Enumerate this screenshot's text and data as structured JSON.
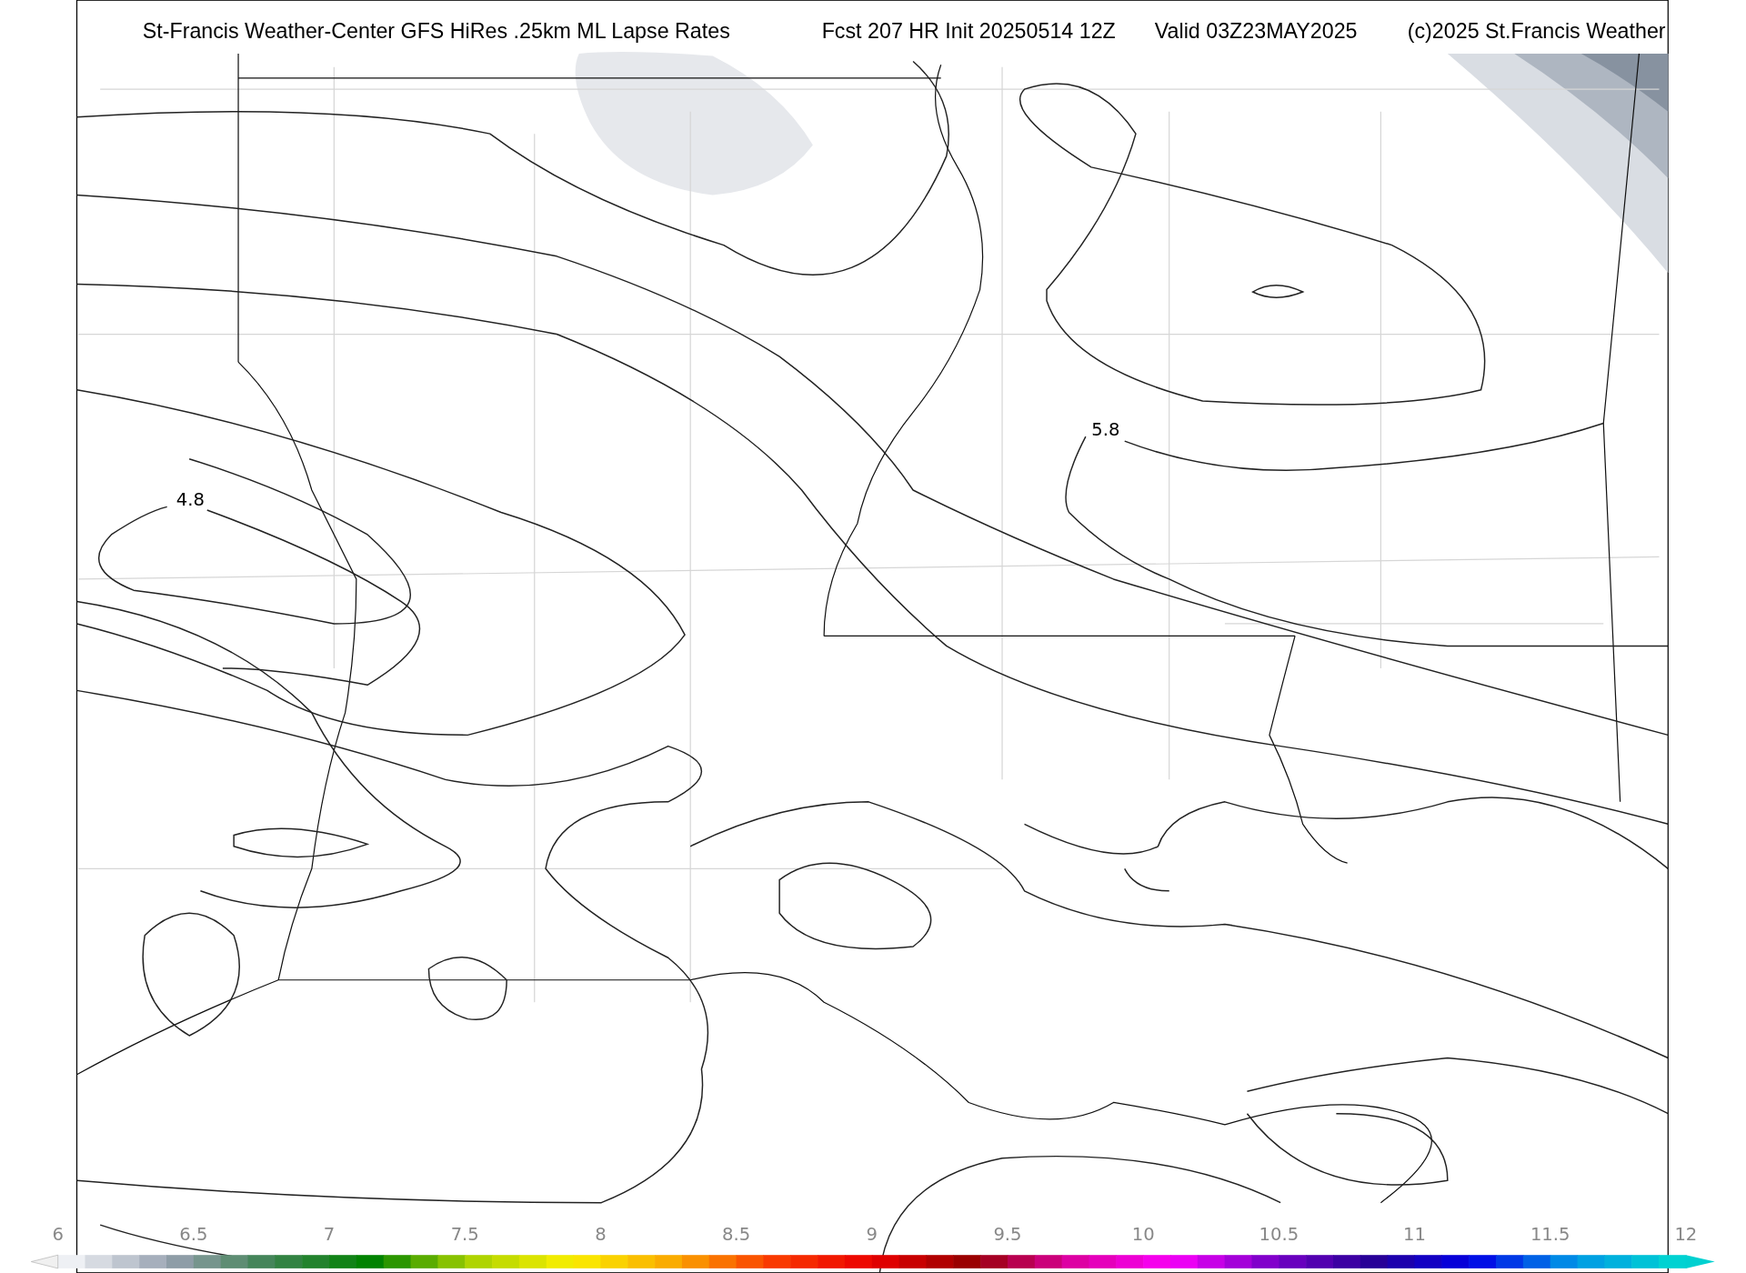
{
  "title_parts": [
    "St-Francis Weather-Center GFS HiRes .25km ML Lapse Rates",
    "Fcst 207 HR Init 20250514 12Z",
    "Valid 03Z23MAY2025",
    "(c)2025 St.Francis Weather"
  ],
  "contour_labels": [
    "4.8",
    "5.8"
  ],
  "colorbar": {
    "ticks": [
      "6",
      "6.5",
      "7",
      "7.5",
      "8",
      "8.5",
      "9",
      "9.5",
      "10",
      "10.5",
      "11",
      "11.5",
      "12"
    ]
  }
}
